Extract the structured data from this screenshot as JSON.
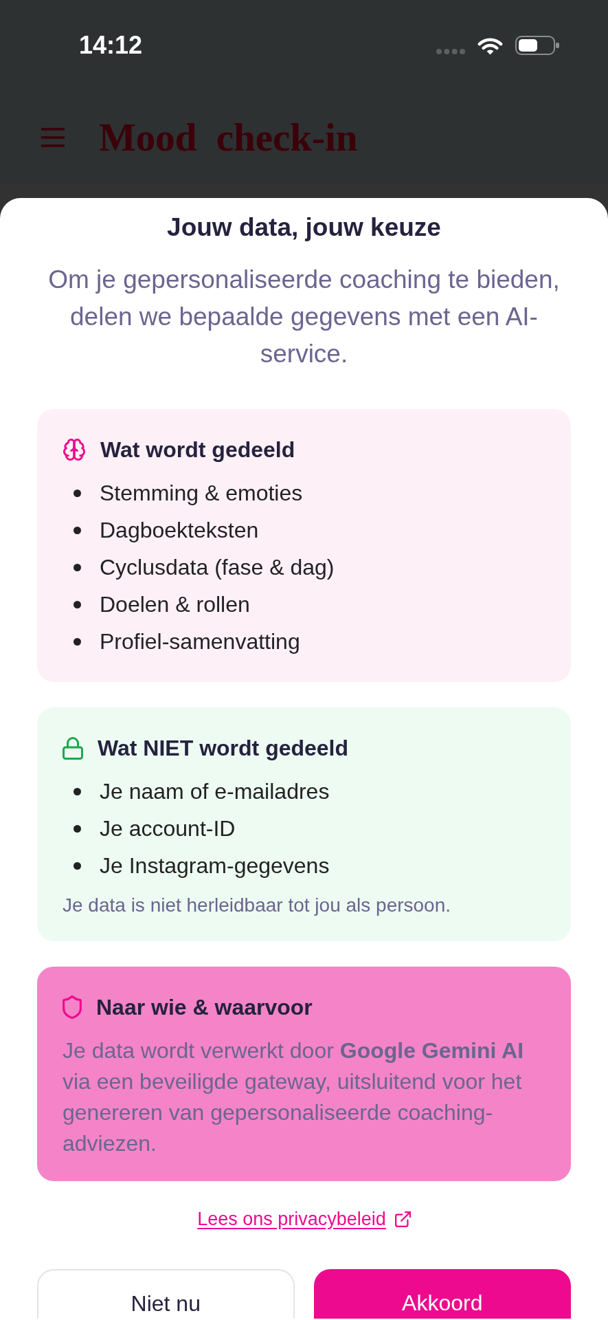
{
  "status_bar": {
    "time": "14:12"
  },
  "app_bar": {
    "title": "Mood check-in"
  },
  "dialog": {
    "title": "Jouw data, jouw keuze",
    "intro": "Om je gepersonaliseerde coaching te bieden, delen we bepaalde gegevens met een AI-service.",
    "sections": [
      {
        "kind": "shared",
        "heading": "Wat wordt gedeeld",
        "items": [
          "Stemming & emoties",
          "Dagboekteksten",
          "Cyclusdata (fase & dag)",
          "Doelen & rollen",
          "Profiel-samenvatting"
        ]
      },
      {
        "kind": "private",
        "heading": "Wat NIET wordt gedeeld",
        "items": [
          "Je naam of e-mailadres",
          "Je account-ID",
          "Je Instagram-gegevens"
        ],
        "note": "Je data is niet herleidbaar tot jou als persoon."
      },
      {
        "kind": "recipient",
        "heading": "Naar wie & waarvoor",
        "body": "Je data wordt verwerkt door **Google Gemini AI** via een beveiligde gateway, uitsluitend voor het genereren van gepersonaliseerde coaching-adviezen."
      }
    ],
    "privacy_link": "Lees ons privacybeleid",
    "buttons": [
      {
        "label": "Niet nu",
        "kind": "secondary"
      },
      {
        "label": "Akkoord",
        "kind": "primary"
      }
    ]
  }
}
